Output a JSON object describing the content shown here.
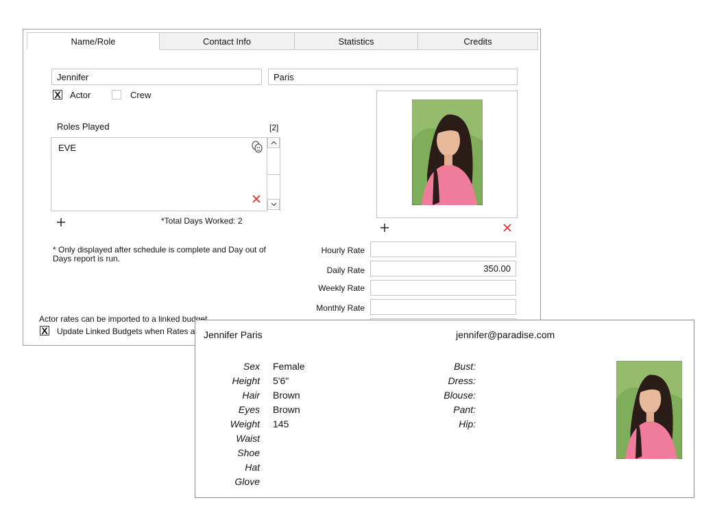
{
  "tabs": [
    "Name/Role",
    "Contact Info",
    "Statistics",
    "Credits"
  ],
  "name": {
    "first": "Jennifer",
    "last": "Paris"
  },
  "role_type": {
    "actor_label": "Actor",
    "actor_checked": "X",
    "crew_label": "Crew"
  },
  "roles": {
    "title": "Roles Played",
    "count": "[2]",
    "items": [
      "EVE"
    ],
    "total_days": "*Total Days Worked: 2",
    "note": "* Only displayed after schedule is complete and Day out of Days report is run."
  },
  "rates": {
    "hourly_label": "Hourly Rate",
    "hourly_value": "",
    "daily_label": "Daily Rate",
    "daily_value": "350.00",
    "weekly_label": "Weekly Rate",
    "weekly_value": "",
    "monthly_label": "Monthly Rate",
    "monthly_value": ""
  },
  "budget": {
    "note": "Actor rates can be imported to a linked budget",
    "update_label": "Update Linked Budgets when Rates ar",
    "update_checked": "X"
  },
  "profile": {
    "name": "Jennifer Paris",
    "email": "jennifer@paradise.com",
    "stats": [
      {
        "label": "Sex",
        "value": "Female"
      },
      {
        "label": "Height",
        "value": "5'6\""
      },
      {
        "label": "Hair",
        "value": "Brown"
      },
      {
        "label": "Eyes",
        "value": "Brown"
      },
      {
        "label": "Weight",
        "value": "145"
      },
      {
        "label": "Waist",
        "value": ""
      },
      {
        "label": "Shoe",
        "value": ""
      },
      {
        "label": "Hat",
        "value": ""
      },
      {
        "label": "Glove",
        "value": ""
      }
    ],
    "measurements": [
      {
        "label": "Bust:",
        "value": ""
      },
      {
        "label": "Dress:",
        "value": ""
      },
      {
        "label": "Blouse:",
        "value": ""
      },
      {
        "label": "Pant:",
        "value": ""
      },
      {
        "label": "Hip:",
        "value": ""
      }
    ]
  },
  "colors": {
    "delete_red": "#e03030",
    "border_gray": "#c4c4c4",
    "photo_bg": "#7fae5a",
    "shirt_pink": "#ef7c9a",
    "hair_dark": "#2a1d18"
  },
  "icons": {
    "add": "plus-icon",
    "delete": "close-icon",
    "role_tag": "masks-icon"
  }
}
